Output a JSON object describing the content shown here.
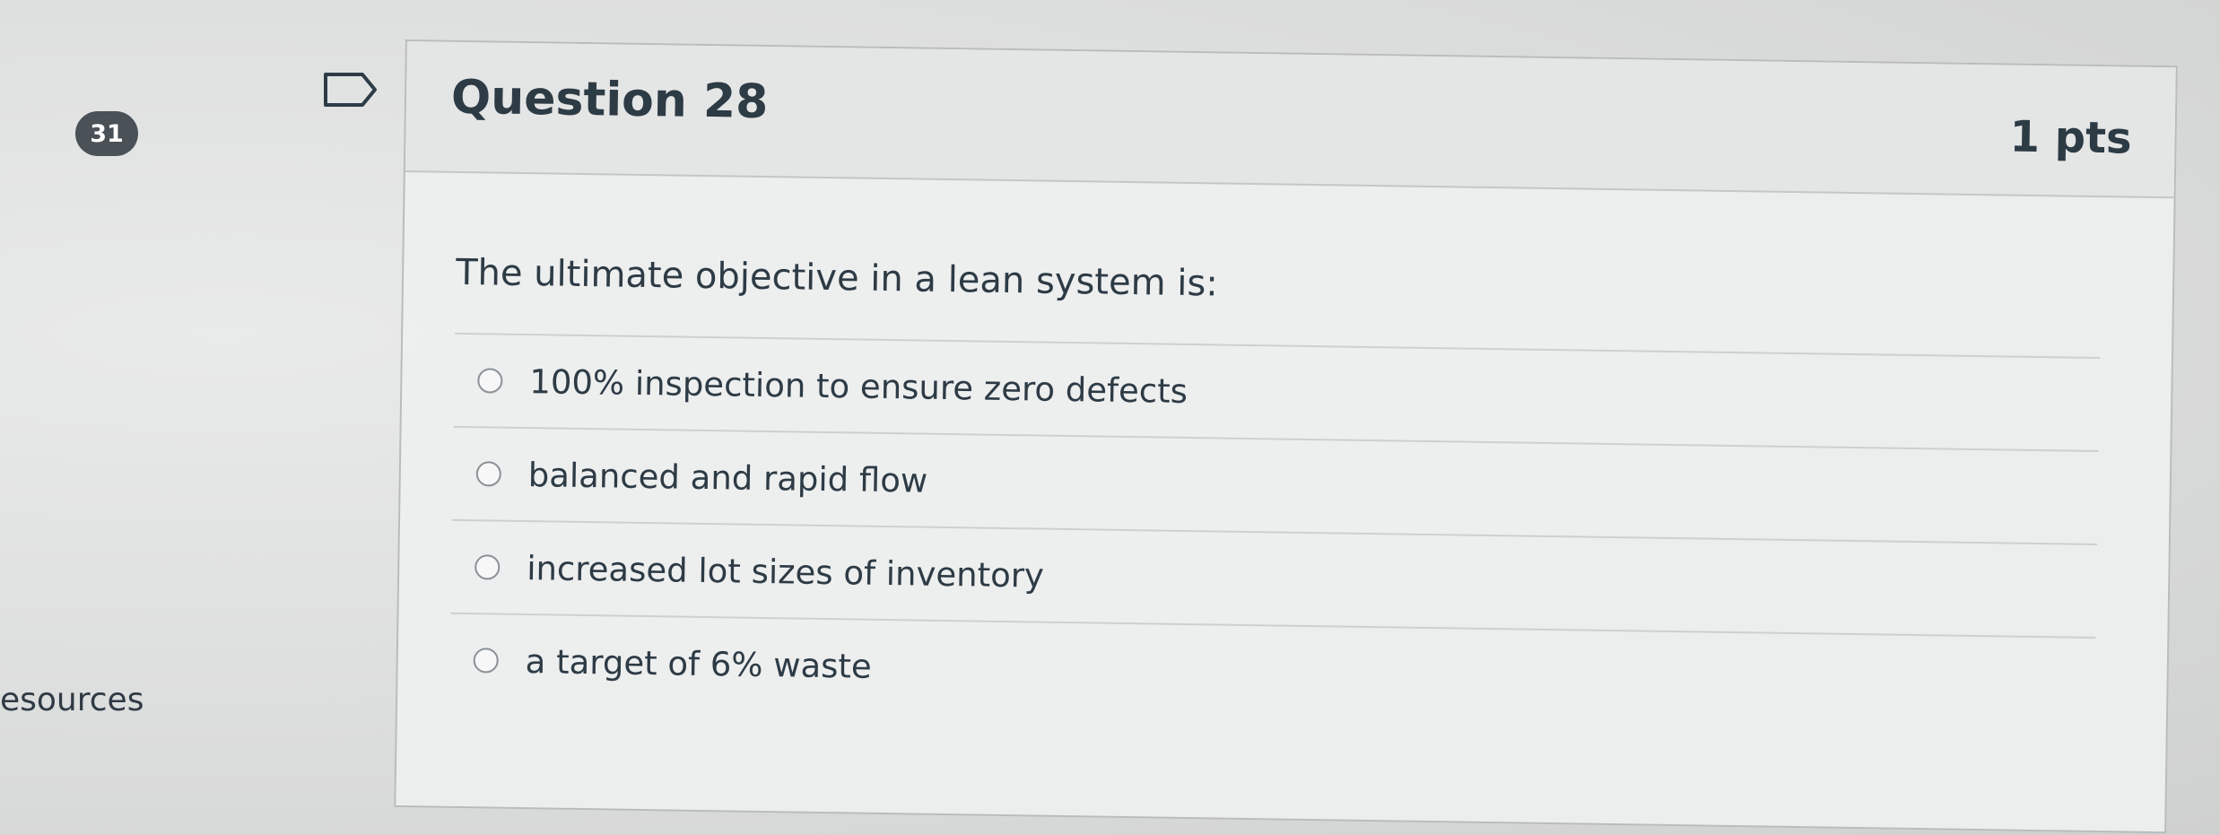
{
  "question_number_badge": "31",
  "sidebar": {
    "resources_label": "esources"
  },
  "question": {
    "title": "Question 28",
    "points": "1 pts",
    "prompt": "The ultimate objective in a lean system is:",
    "answers": [
      {
        "label": "100% inspection to ensure zero defects"
      },
      {
        "label": "balanced and rapid flow"
      },
      {
        "label": "increased lot sizes of inventory"
      },
      {
        "label": "a target of 6% waste"
      }
    ]
  },
  "icons": {
    "flag": "flag-icon",
    "radio": "radio-button-icon"
  },
  "colors": {
    "badge_bg": "#4a5157",
    "text": "#2d3b45",
    "card_border": "#b9bcbe"
  }
}
